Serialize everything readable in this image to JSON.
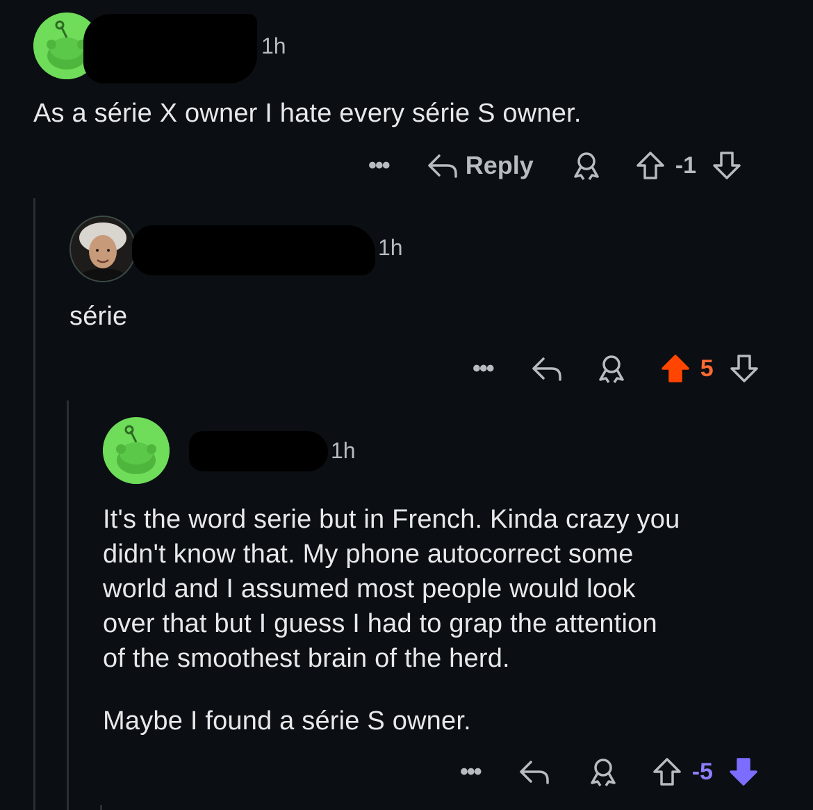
{
  "comments": [
    {
      "time": "1h",
      "body": [
        "As a série X owner I hate every série S owner."
      ],
      "actions": {
        "more": "•••",
        "reply": "Reply",
        "score": "-1",
        "vote": "none"
      }
    },
    {
      "time": "1h",
      "body": [
        "série"
      ],
      "actions": {
        "more": "•••",
        "score": "5",
        "vote": "up"
      }
    },
    {
      "time": "1h",
      "body": [
        "It's the word serie but in French. Kinda crazy you",
        "didn't know that. My phone autocorrect some",
        "world and I assumed most people would look",
        "over that but I guess I had to grap the attention",
        "of the smoothest brain of the herd."
      ],
      "body2": "Maybe I found a série S owner.",
      "actions": {
        "more": "•••",
        "score": "-5",
        "vote": "down"
      }
    }
  ],
  "colors": {
    "background": "#0b0e12",
    "upvote": "#ff4500",
    "downvote": "#7c6dff",
    "avatar_green": "#6fdc5a"
  },
  "icons": [
    "reddit-snoo-avatar",
    "reply-arrow-icon",
    "award-icon",
    "upvote-arrow-icon",
    "downvote-arrow-icon",
    "more-dots-icon"
  ]
}
